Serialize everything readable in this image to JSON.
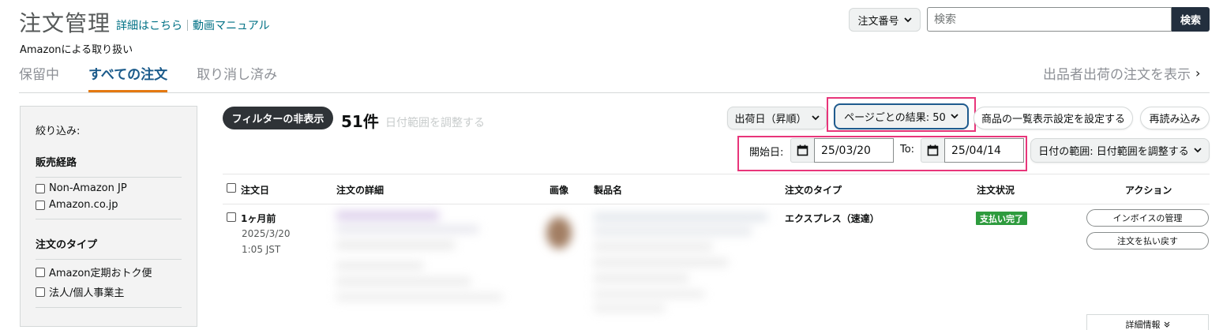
{
  "header": {
    "title": "注文管理",
    "help_link": "詳細はこちら",
    "video_link": "動画マニュアル",
    "subheading": "Amazonによる取り扱い"
  },
  "search": {
    "select_label": "注文番号",
    "placeholder": "検索",
    "button_label": "検索"
  },
  "tabs": [
    {
      "label": "保留中",
      "active": false
    },
    {
      "label": "すべての注文",
      "active": true
    },
    {
      "label": "取り消し済み",
      "active": false
    }
  ],
  "show_seller_orders": "出品者出荷の注文を表示",
  "sidebar": {
    "heading": "絞り込み:",
    "sections": [
      {
        "title": "販売経路",
        "options": [
          "Non-Amazon JP",
          "Amazon.co.jp"
        ]
      },
      {
        "title": "注文のタイプ",
        "options": [
          "Amazon定期おトク便",
          "法人/個人事業主"
        ]
      }
    ]
  },
  "toolbar": {
    "filter_toggle": "フィルターの非表示",
    "result_count": "51件",
    "adjust_hint": "日付範囲を調整する",
    "sort_label": "出荷日（昇順）",
    "per_page_label": "ページごとの結果: 50",
    "list_settings_label": "商品の一覧表示設定を設定する",
    "reload_label": "再読み込み"
  },
  "date_filter": {
    "start_label": "開始日:",
    "start_date": "25/03/20",
    "to_label": "To:",
    "end_date": "25/04/14",
    "range_label": "日付の範囲: 日付範囲を調整する"
  },
  "table": {
    "columns": [
      "注文日",
      "注文の詳細",
      "画像",
      "製品名",
      "注文のタイプ",
      "注文状況",
      "アクション"
    ],
    "rows": [
      {
        "age": "1ヶ月前",
        "date": "2025/3/20",
        "time": "1:05 JST",
        "order_type": "エクスプレス（速達）",
        "status": "支払い完了",
        "actions": [
          "インボイスの管理",
          "注文を払い戻す"
        ],
        "more_info": "詳細情報"
      }
    ]
  },
  "colors": {
    "highlight": "#e8357a",
    "tab_underline": "#e47911",
    "status_green": "#2e9b3e",
    "search_button": "#232f3e"
  }
}
